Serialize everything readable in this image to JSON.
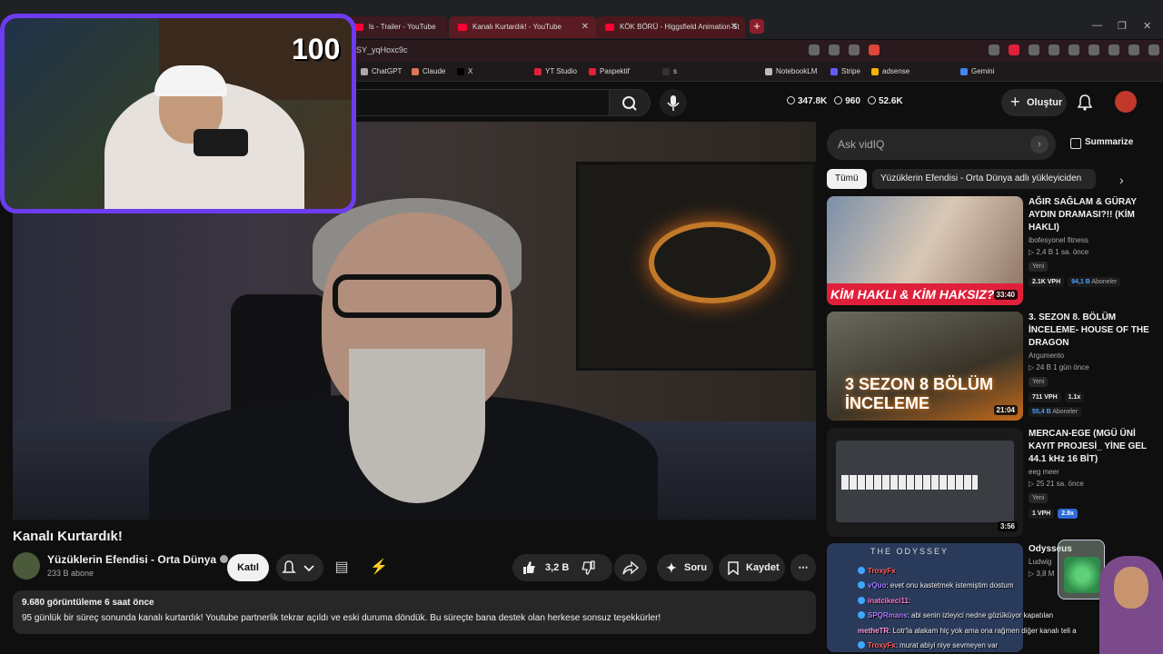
{
  "browser": {
    "tabs": [
      {
        "title": "ls - Trailer - YouTube"
      },
      {
        "title": "Kanalı Kurtardık! - YouTube"
      },
      {
        "title": "KÖK BÖRÜ - Higgsfield Animation St"
      }
    ],
    "url": "SY_yqHoxc9c",
    "bookmarks": [
      "ChatGPT",
      "Claude",
      "X",
      "YT Studio",
      "Paspektif",
      "s",
      "NotebookLM",
      "Stripe",
      "adsense",
      "Gemini"
    ]
  },
  "webcam": {
    "count": "100"
  },
  "header": {
    "stats": [
      {
        "value": "347.8K"
      },
      {
        "value": "960"
      },
      {
        "value": "52.6K"
      }
    ],
    "create_label": "Oluştur"
  },
  "video": {
    "title": "Kanalı Kurtardık!",
    "channel": "Yüzüklerin Efendisi - Orta Dünya",
    "subscribers": "233 B abone",
    "join_label": "Katıl",
    "likes": "3,2 B",
    "ask_label": "Soru",
    "save_label": "Kaydet",
    "description": {
      "meta": "9.680 görüntüleme  6 saat önce",
      "text": "95 günlük bir süreç sonunda kanalı kurtardık! Youtube partnerlik tekrar açıldı ve eski duruma döndük. Bu süreçte bana destek olan herkese sonsuz teşekkürler!"
    }
  },
  "sidebar": {
    "ask_placeholder": "Ask vidIQ",
    "summarize_label": "Summarize",
    "chips": [
      "Tümü",
      "Yüzüklerin Efendisi - Orta Dünya adlı yükleyiciden"
    ],
    "recs": [
      {
        "title": "AĞIR SAĞLAM & GÜRAY AYDIN DRAMASI?!! (KİM HAKLI)",
        "channel": "ibofesyonel fitness",
        "meta": "▷ 2,4 B  1 sa. önce",
        "badge": "Yeni",
        "vph": "2.1K VPH",
        "subs": "94,1 B",
        "subs_suffix": "Aboneler",
        "mult": "",
        "duration": "33:40",
        "thumb_caption": "KİM HAKLI & KİM HAKSIZ?"
      },
      {
        "title": "3. SEZON 8. BÖLÜM İNCELEME- HOUSE OF THE DRAGON",
        "channel": "Argumento",
        "meta": "▷ 24 B  1 gün önce",
        "badge": "Yeni",
        "vph": "711 VPH",
        "subs": "55,4 B",
        "subs_suffix": "Aboneler",
        "mult": "1.1x",
        "duration": "21:04",
        "thumb_caption": "3 SEZON 8 BÖLÜM İNCELEME"
      },
      {
        "title": "MERCAN-EGE (MGÜ ÜNİ KAYIT PROJESİ_ YİNE GEL 44.1 kHz 16 BİT)",
        "channel": "eeg meer",
        "meta": "▷ 25  21 sa. önce",
        "badge": "Yeni",
        "vph": "1 VPH",
        "subs": "",
        "subs_suffix": "",
        "mult": "2.9x",
        "duration": "3:56",
        "thumb_caption": ""
      },
      {
        "title": "Odysseus",
        "channel": "Ludwig",
        "meta": "▷ 3,8 M",
        "badge": "",
        "vph": "",
        "subs": "",
        "subs_suffix": "",
        "mult": "",
        "duration": "",
        "thumb_caption": "THE ODYSSEY"
      }
    ]
  },
  "chat": [
    {
      "user": "TroxyFx",
      "msg": ""
    },
    {
      "user": "vQuo",
      "msg": ": evet onu kastetmek istemiştim dostum"
    },
    {
      "user": "inatcikeci11",
      "msg": ": "
    },
    {
      "user": "SPQRmans",
      "msg": ": abi senin izleyici nedne gözüküyor kapatılan"
    },
    {
      "user": "metheTR",
      "msg": ": Lotr'la alakam hiç yok ama ona rağmen diğer kanalı teli a"
    },
    {
      "user": "TroxyFx",
      "msg": ": murat abiyi niye sevmeyen var"
    }
  ],
  "colors": {
    "accent": "#ff0033",
    "webcam_border": "#6d3cf0",
    "vidiq_blue": "#4b9fff"
  }
}
